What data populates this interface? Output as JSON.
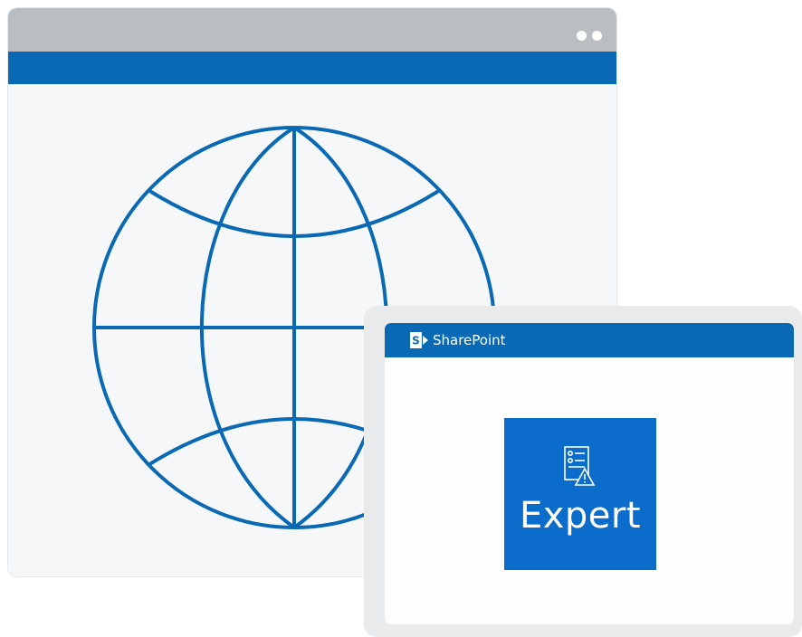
{
  "back_window": {
    "titlebar_color": "#b8bec2",
    "accent_bar_color": "#0a69b4",
    "window_controls": [
      "dot-icon",
      "dot-icon"
    ],
    "illustration_icon": "globe-icon"
  },
  "front_window": {
    "app": {
      "logo_icon": "sharepoint-logo-icon",
      "name": "SharePoint"
    },
    "tile": {
      "icon": "checklist-warning-icon",
      "label": "Expert",
      "color": "#0c6ccb"
    }
  }
}
